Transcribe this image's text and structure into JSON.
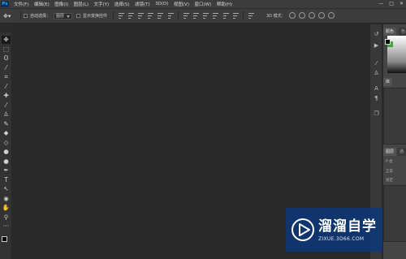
{
  "app": {
    "logo_text": "Ps"
  },
  "menu": {
    "items": [
      "文件(F)",
      "编辑(E)",
      "图像(I)",
      "图层(L)",
      "文字(Y)",
      "选择(S)",
      "滤镜(T)",
      "3D(D)",
      "视图(V)",
      "窗口(W)",
      "帮助(H)"
    ],
    "window_controls": [
      "—",
      "□",
      "✕"
    ]
  },
  "options_bar": {
    "auto_select_label": "自动选择：",
    "auto_select_value": "图层",
    "show_transform_label": "显示变换控件",
    "mode_3d_label": "3D 模式："
  },
  "toolbar": {
    "tools": [
      {
        "icon": "move-icon",
        "glyph": "✥"
      },
      {
        "icon": "marquee-icon",
        "glyph": "⬚"
      },
      {
        "icon": "lasso-icon",
        "glyph": "ʘ"
      },
      {
        "icon": "magic-wand-icon",
        "glyph": "⁄"
      },
      {
        "icon": "crop-icon",
        "glyph": "⌗"
      },
      {
        "icon": "eyedropper-icon",
        "glyph": "⁄"
      },
      {
        "icon": "healing-brush-icon",
        "glyph": "✚"
      },
      {
        "icon": "brush-icon",
        "glyph": "⁄"
      },
      {
        "icon": "clone-stamp-icon",
        "glyph": "♙"
      },
      {
        "icon": "history-brush-icon",
        "glyph": "✎"
      },
      {
        "icon": "eraser-icon",
        "glyph": "◆"
      },
      {
        "icon": "paint-bucket-icon",
        "glyph": "◇"
      },
      {
        "icon": "blur-icon",
        "glyph": "●"
      },
      {
        "icon": "dodge-icon",
        "glyph": "●"
      },
      {
        "icon": "pen-icon",
        "glyph": "✒"
      },
      {
        "icon": "type-icon",
        "glyph": "T"
      },
      {
        "icon": "path-selection-icon",
        "glyph": "↖"
      },
      {
        "icon": "shape-icon",
        "glyph": "◉"
      },
      {
        "icon": "hand-icon",
        "glyph": "✋"
      },
      {
        "icon": "zoom-icon",
        "glyph": "⚲"
      },
      {
        "icon": "more-tools-icon",
        "glyph": "···"
      }
    ],
    "foreground_color": "#000000",
    "background_color": "#ffffff"
  },
  "panels": {
    "tab_color": "颜色",
    "tab_color_short": "色",
    "tab_library": "库",
    "tab_layers": "图层",
    "tab_channels": "通",
    "layers_filter": "P 类",
    "layers_normal": "正常",
    "layers_lock": "锁定",
    "panel_fg": "#000000",
    "panel_bg": "#3fa63a"
  },
  "watermark": {
    "title": "溜溜自学",
    "url": "ZIXUE.3D66.COM"
  }
}
